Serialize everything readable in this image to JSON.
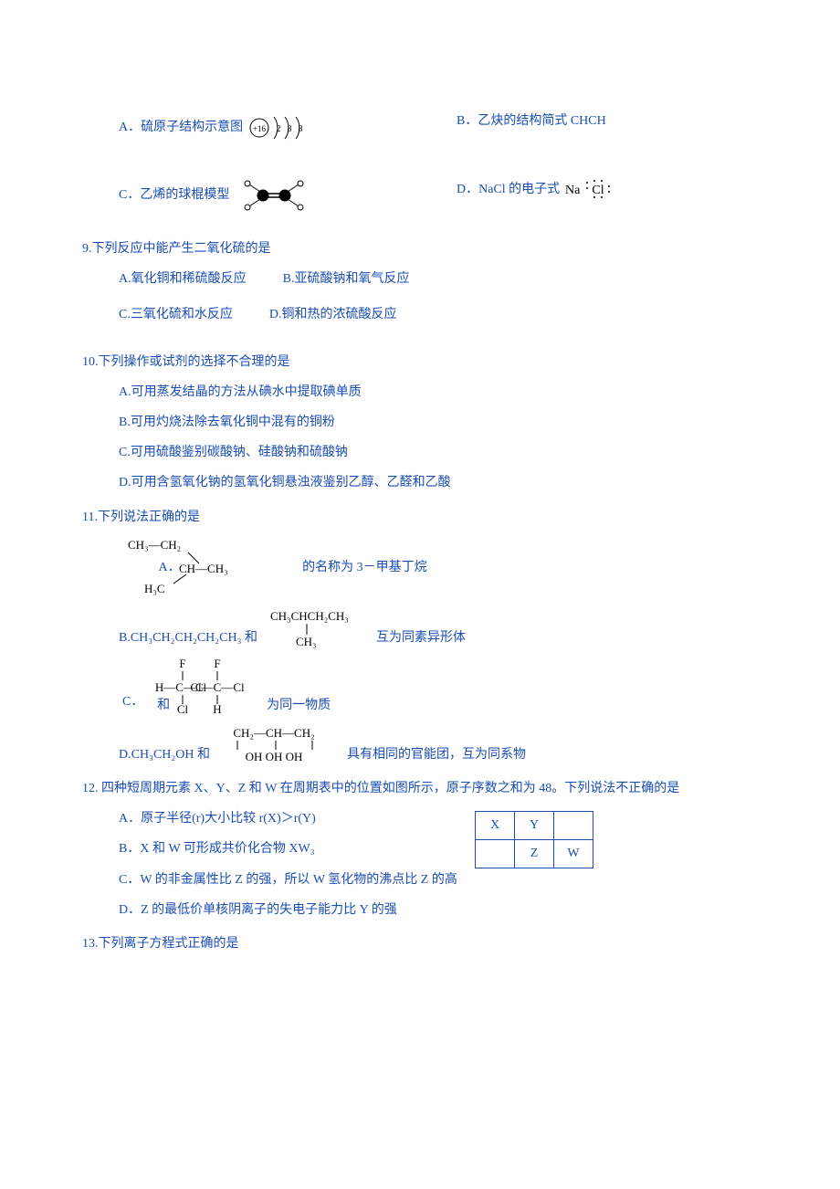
{
  "q8": {
    "a_label": "A．",
    "a_text": "硫原子结构示意图",
    "b_label": "B．",
    "b_text": "乙炔的结构简式 CHCH",
    "c_label": "C．",
    "c_text": "乙烯的球棍模型",
    "d_label": "D．",
    "d_text": "NaCl 的电子式",
    "sulfur_core": "+16",
    "sulfur_shell1": "2",
    "sulfur_shell2": "8",
    "sulfur_shell3": "8",
    "nacl_na": "Na",
    "nacl_cl": "Cl"
  },
  "q9": {
    "head": "9.下列反应中能产生二氧化硫的是",
    "a": "A.氧化铜和稀硫酸反应",
    "b": "B.亚硫酸钠和氧气反应",
    "c": "C.三氧化硫和水反应",
    "d": "D.铜和热的浓硫酸反应"
  },
  "q10": {
    "head": "10.下列操作或试剂的选择不合理的是",
    "a": "A.可用蒸发结晶的方法从碘水中提取碘单质",
    "b": "B.可用灼烧法除去氧化铜中混有的铜粉",
    "c": "C.可用硫酸鉴别碳酸钠、硅酸钠和硫酸钠",
    "d": "D.可用含氢氧化钠的氢氧化铜悬浊液鉴别乙醇、乙醛和乙酸"
  },
  "q11": {
    "head": "11.下列说法正确的是",
    "a_label": "A．",
    "a_text": "的名称为 3－甲基丁烷",
    "a_mol": {
      "l1": "CH₃—CH₂",
      "l2": "CH—CH₃",
      "l3": "H₃C"
    },
    "b_label": "B.",
    "b_pre": "CH₃CH₂CH₂CH₂CH₃ 和",
    "b_post": "互为同素异形体",
    "b_mol": {
      "l1": "CH₃CHCH₂CH₃",
      "l2": "CH₃"
    },
    "c_label": "C．",
    "c_mid": "和",
    "c_post": "为同一物质",
    "c_mol1": {
      "t": "F",
      "m": "H—C—Cl",
      "b": "Cl"
    },
    "c_mol2": {
      "t": "F",
      "m": "Cl—C—Cl",
      "b": "H"
    },
    "d_label": "D.",
    "d_pre": "CH₃CH₂OH 和",
    "d_post": "具有相同的官能团，互为同系物",
    "d_mol": {
      "t": "CH₂—CH—CH₂",
      "b": "OH    OH   OH"
    }
  },
  "q12": {
    "head": "12. 四种短周期元素 X、Y、Z 和 W 在周期表中的位置如图所示，原子序数之和为 48。下列说法不正确的是",
    "a": "A．原子半径(r)大小比较 r(X)＞r(Y)",
    "b": "B．X 和 W 可形成共价化合物 XW₃",
    "c": "C．W 的非金属性比 Z 的强，所以 W 氢化物的沸点比 Z 的高",
    "d": "D．Z 的最低价单核阴离子的失电子能力比 Y 的强",
    "tbl": {
      "x": "X",
      "y": "Y",
      "z": "Z",
      "w": "W"
    }
  },
  "q13": {
    "head": "13.下列离子方程式正确的是"
  }
}
